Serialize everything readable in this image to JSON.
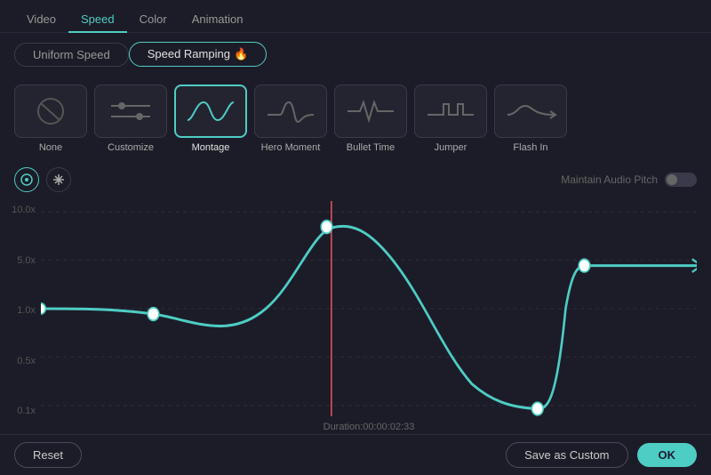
{
  "topNav": {
    "tabs": [
      {
        "label": "Video",
        "active": false
      },
      {
        "label": "Speed",
        "active": true
      },
      {
        "label": "Color",
        "active": false
      },
      {
        "label": "Animation",
        "active": false
      }
    ]
  },
  "modeSwitcher": {
    "uniformSpeed": "Uniform Speed",
    "speedRamping": "Speed Ramping",
    "activeMode": "speedRamping"
  },
  "presets": [
    {
      "id": "none",
      "label": "None",
      "selected": false
    },
    {
      "id": "customize",
      "label": "Customize",
      "selected": false
    },
    {
      "id": "montage",
      "label": "Montage",
      "selected": true
    },
    {
      "id": "hero-moment",
      "label": "Hero Moment",
      "selected": false
    },
    {
      "id": "bullet-time",
      "label": "Bullet Time",
      "selected": false
    },
    {
      "id": "jumper",
      "label": "Jumper",
      "selected": false
    },
    {
      "id": "flash-in",
      "label": "Flash In",
      "selected": false
    }
  ],
  "controls": {
    "bezierBtn": "⊙",
    "freezeBtn": "❄",
    "audioLabel": "Maintain Audio Pitch"
  },
  "chart": {
    "yLabels": [
      "10.0x",
      "5.0x",
      "1.0x",
      "0.5x",
      "0.1x"
    ],
    "duration": "Duration:00:00:02:33"
  },
  "bottomBar": {
    "resetLabel": "Reset",
    "saveAsCustomLabel": "Save as Custom",
    "okLabel": "OK"
  }
}
